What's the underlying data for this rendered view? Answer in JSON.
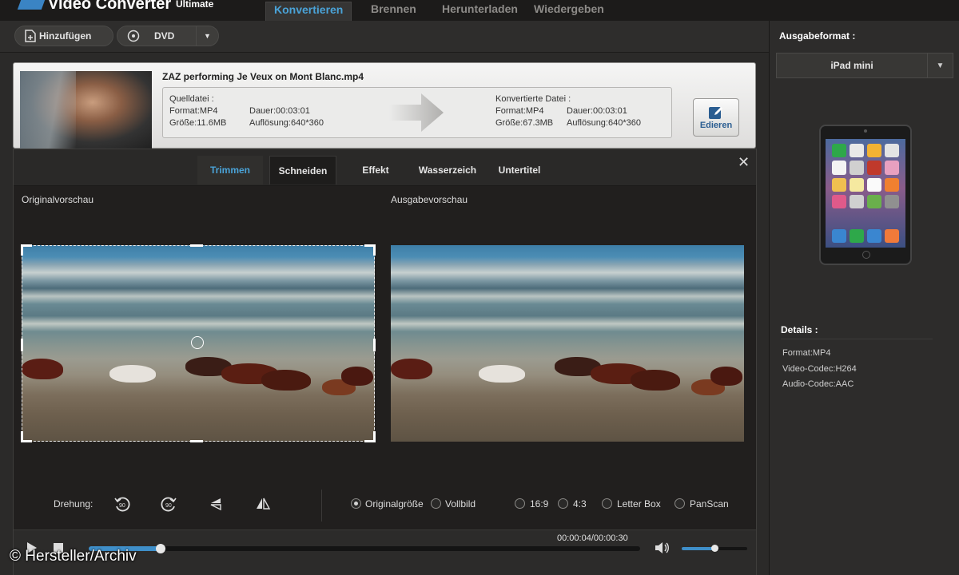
{
  "app": {
    "title": "Video Converter",
    "edition": "Ultimate"
  },
  "main_tabs": [
    {
      "label": "Konvertieren",
      "active": true
    },
    {
      "label": "Brennen",
      "active": false
    },
    {
      "label": "Herunterladen",
      "active": false
    },
    {
      "label": "Wiedergeben",
      "active": false
    }
  ],
  "toolbar": {
    "add_label": "Hinzufügen",
    "dvd_label": "DVD"
  },
  "output_panel": {
    "label": "Ausgabeformat :",
    "selected": "iPad mini",
    "device_icon": "ipad-mini-device",
    "details_label": "Details :",
    "details": [
      "Format:MP4",
      "Video-Codec:H264",
      "Audio-Codec:AAC"
    ]
  },
  "file": {
    "name": "ZAZ performing Je Veux on Mont Blanc.mp4",
    "source": {
      "heading": "Quelldatei :",
      "format": "Format:MP4",
      "duration": "Dauer:00:03:01",
      "size": "Größe:11.6MB",
      "resolution": "Auflösung:640*360"
    },
    "converted": {
      "heading": "Konvertierte Datei :",
      "format": "Format:MP4",
      "duration": "Dauer:00:03:01",
      "size": "Größe:67.3MB",
      "resolution": "Auflösung:640*360"
    },
    "edit_label": "Edieren"
  },
  "editor": {
    "tabs": [
      {
        "label": "Trimmen",
        "state": "highlight"
      },
      {
        "label": "Schneiden",
        "state": "active"
      },
      {
        "label": "Effekt",
        "state": "normal"
      },
      {
        "label": "Wasserzeich",
        "state": "normal"
      },
      {
        "label": "Untertitel",
        "state": "normal"
      }
    ],
    "close_glyph": "✕",
    "original_preview_label": "Originalvorschau",
    "output_preview_label": "Ausgabevorschau",
    "rotation_label": "Drehung:",
    "rotation_icons": [
      "rotate-left-90-icon",
      "rotate-right-90-icon",
      "flip-horizontal-icon",
      "flip-vertical-icon"
    ],
    "size_options": [
      {
        "label": "Originalgröße",
        "selected": true
      },
      {
        "label": "Vollbild",
        "selected": false
      }
    ],
    "aspect_options": [
      {
        "label": "16:9",
        "selected": false
      },
      {
        "label": "4:3",
        "selected": false
      },
      {
        "label": "Letter Box",
        "selected": false
      },
      {
        "label": "PanScan",
        "selected": false
      }
    ],
    "playback": {
      "time": "00:00:04/00:00:30",
      "progress_fraction": 0.13,
      "volume_fraction": 0.5
    }
  },
  "watermark": "© Hersteller/Archiv",
  "colors": {
    "accent": "#4aa3d8",
    "panel": "#211f1e",
    "progress": "#3f8fc9"
  }
}
